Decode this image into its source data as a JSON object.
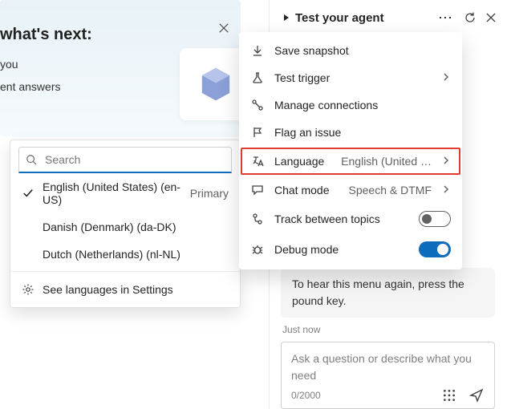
{
  "card": {
    "title": "what's next:",
    "line1": "you",
    "line2": "ent answers"
  },
  "lang_popover": {
    "search_placeholder": "Search",
    "items": [
      {
        "label": "English (United States) (en-US)",
        "selected": true,
        "badge": "Primary"
      },
      {
        "label": "Danish (Denmark) (da-DK)",
        "selected": false,
        "badge": ""
      },
      {
        "label": "Dutch (Netherlands) (nl-NL)",
        "selected": false,
        "badge": ""
      }
    ],
    "settings_label": "See languages in Settings"
  },
  "panel": {
    "title": "Test your agent"
  },
  "menu": {
    "save_snapshot": "Save snapshot",
    "test_trigger": "Test trigger",
    "manage_connections": "Manage connections",
    "flag_issue": "Flag an issue",
    "language_label": "Language",
    "language_value": "English (United …",
    "chat_mode_label": "Chat mode",
    "chat_mode_value": "Speech & DTMF",
    "track_topics": "Track between topics",
    "debug_mode": "Debug mode",
    "track_on": false,
    "debug_on": true
  },
  "chat": {
    "bubble": "To hear this menu again, press the pound key.",
    "timestamp": "Just now",
    "placeholder": "Ask a question or describe what you need",
    "char_count": "0/2000"
  }
}
